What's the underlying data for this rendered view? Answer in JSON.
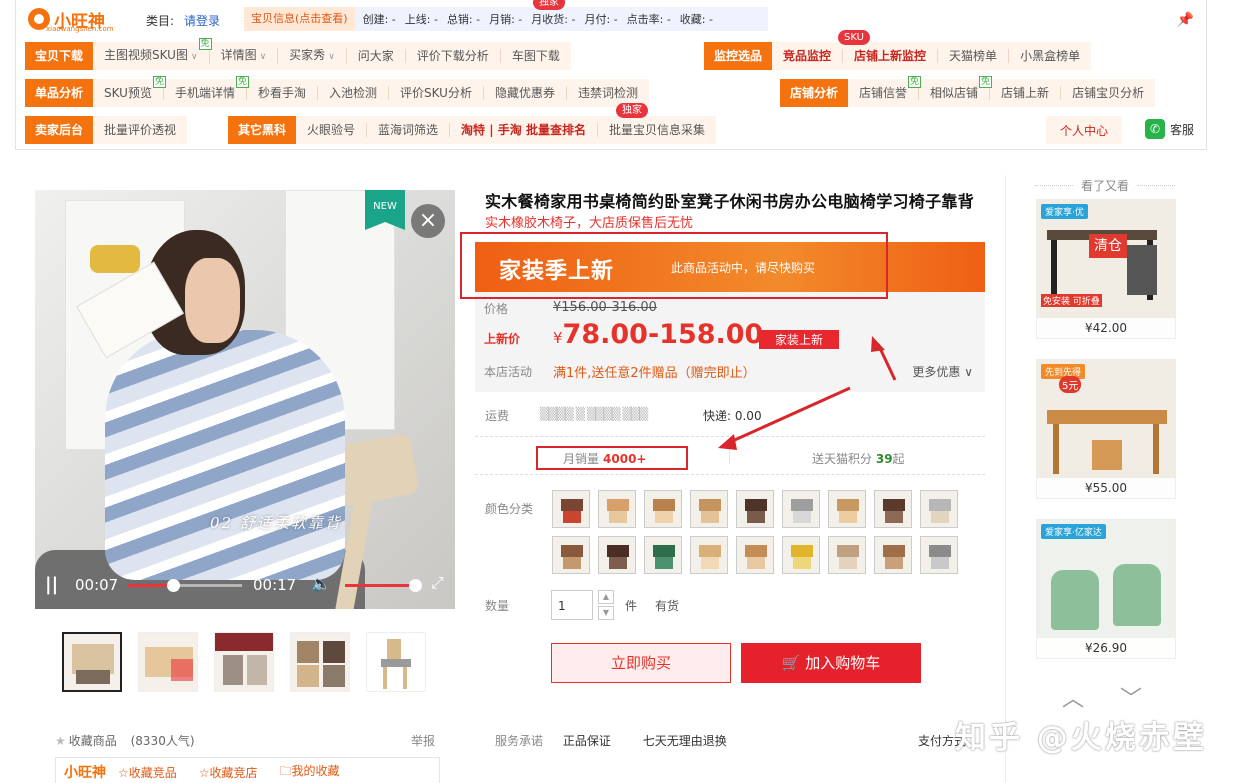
{
  "plugin": {
    "logo_text": "小旺神",
    "logo_sub": "xiaowangshen.com",
    "category_label": "类目:",
    "login_text": "请登录",
    "info_link": "宝贝信息(点击查看)",
    "info_fields": [
      "创建: -",
      "上线: -",
      "总销: -",
      "月销: -",
      "月收货: -",
      "月付: -",
      "点击率: -",
      "收藏: -"
    ],
    "exclusive_badge": "独家",
    "sku_badge": "SKU",
    "free_badge": "免",
    "row1": [
      {
        "title": "宝贝下载",
        "items": [
          "主图视频SKU图",
          "详情图",
          "买家秀",
          "问大家",
          "评价下载分析",
          "车图下载"
        ]
      },
      {
        "title": "监控选品",
        "items": [
          "竞品监控",
          "店铺上新监控",
          "天猫榜单",
          "小黑盒榜单"
        ]
      }
    ],
    "row2": [
      {
        "title": "单品分析",
        "items": [
          "SKU预览",
          "手机端详情",
          "秒看手淘",
          "入池检测",
          "评价SKU分析",
          "隐藏优惠券",
          "违禁词检测"
        ]
      },
      {
        "title": "店铺分析",
        "items": [
          "店铺信誉",
          "相似店铺",
          "店铺上新",
          "店铺宝贝分析"
        ]
      }
    ],
    "row3": [
      {
        "title": "卖家后台",
        "items": [
          "批量评价透视"
        ]
      },
      {
        "title": "其它黑科",
        "items": [
          "火眼验号",
          "蓝海词筛选",
          "淘特 | 手淘 批量查排名",
          "批量宝贝信息采集"
        ]
      }
    ],
    "personal_center": "个人中心",
    "service": "客服"
  },
  "gallery": {
    "new_tag": "NEW",
    "close_icon": "×",
    "caption": "02  舒适柔软靠背",
    "current_time": "00:07",
    "duration": "00:17",
    "progress_fraction": 0.4,
    "volume_fraction": 1.0,
    "favorite_label": "收藏商品",
    "favorite_count": "(8330人气)",
    "report": "举报",
    "ww_logo": "小旺神",
    "ww_items": [
      "☆收藏竞品",
      "☆收藏竞店",
      "我的收藏"
    ]
  },
  "product": {
    "title": "实木餐椅家用书桌椅简约卧室凳子休闲书房办公电脑椅学习椅子靠背",
    "subtitle": "实木橡胶木椅子，大店质保售后无忧",
    "promo_big": "家装季上新",
    "promo_small": "此商品活动中，请尽快购买",
    "price_label": "价格",
    "original_price": "¥156.00-316.00",
    "sale_label": "上新价",
    "sale_currency": "¥",
    "sale_price": "78.00-158.00",
    "sale_badge": "家装上新",
    "store_promo_label": "本店活动",
    "store_promo": "满1件,送任意2件赠品（赠完即止）",
    "more_coupons": "更多优惠",
    "shipping_label": "运费",
    "shipping_blur": "▒▒▒▒ ▒ ▒▒▒▒ ▒▒▒",
    "express": "快递: 0.00",
    "monthly_label": "月销量",
    "monthly_value": "4000+",
    "points_label": "送天猫积分",
    "points_value": "39",
    "points_suffix": "起",
    "color_label": "颜色分类",
    "qty_label": "数量",
    "qty_value": "1",
    "unit": "件",
    "stock": "有货",
    "buy_now": "立即购买",
    "add_cart": "加入购物车",
    "service_label": "服务承诺",
    "service_items": [
      "正品保证",
      "七天无理由退换"
    ],
    "pay_label": "支付方式"
  },
  "sidebar": {
    "title": "看了又看",
    "items": [
      {
        "price": "¥42.00",
        "tag": "爱家享·优",
        "overlay": "清仓",
        "sub": "免安装  可折叠"
      },
      {
        "price": "¥55.00",
        "tag": "先到先得",
        "overlay": "5元"
      },
      {
        "price": "¥26.90",
        "tag": "爱家享·亿家达"
      }
    ],
    "up_arrow": "︿",
    "down_arrow": "﹀"
  },
  "watermark": "知乎 @火烧赤壁",
  "colors": {
    "accent": "#f5730f",
    "price_red": "#e5332b",
    "annotation": "#d8262c"
  }
}
